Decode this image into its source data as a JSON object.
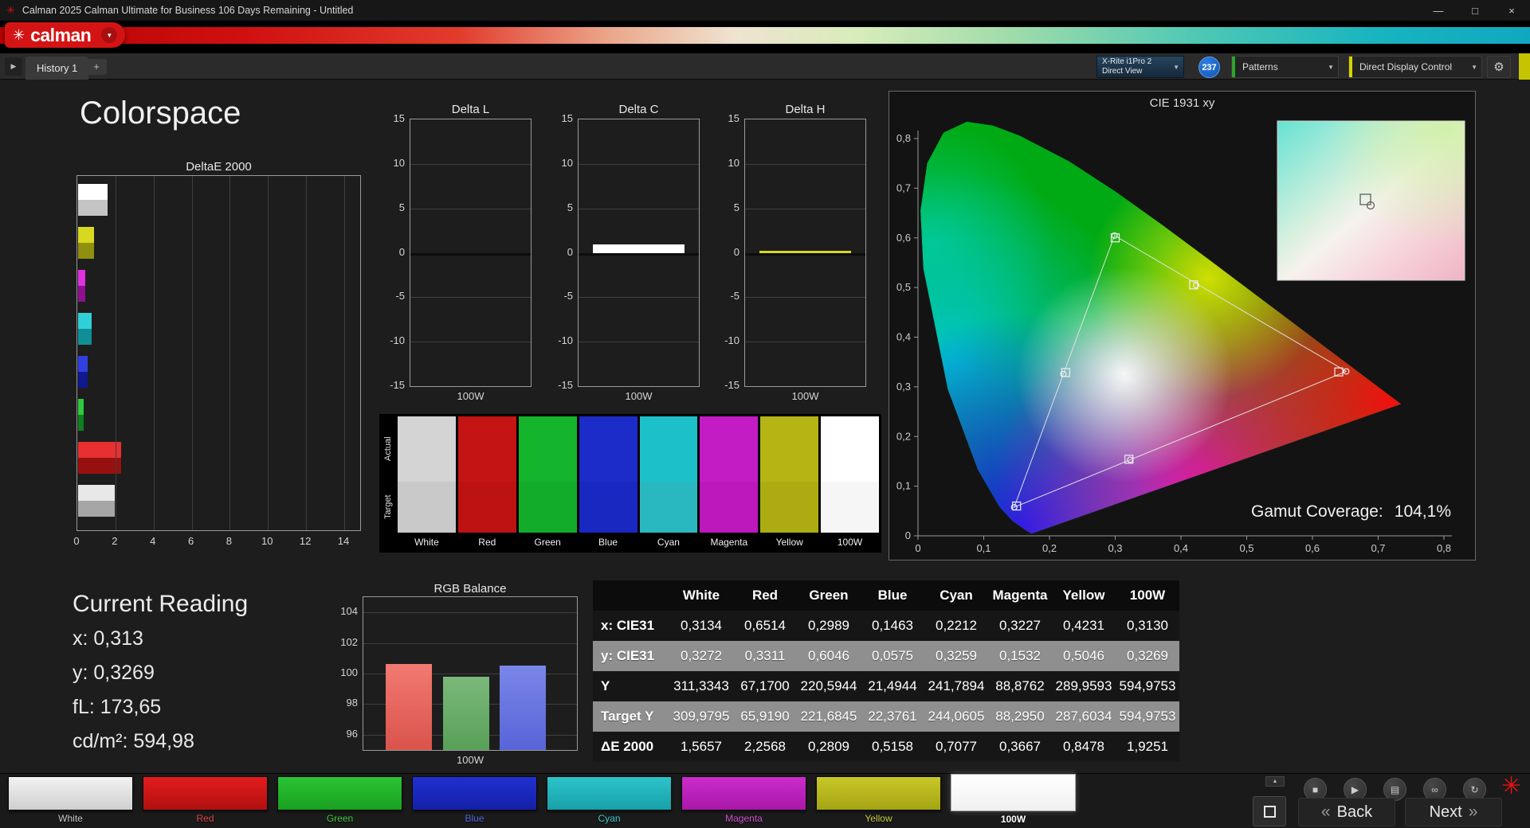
{
  "window": {
    "title": "Calman 2025 Calman Ultimate for Business 106 Days Remaining  - Untitled"
  },
  "brand": {
    "name": "calman"
  },
  "icons": {
    "app": "✳",
    "logo_mark": "✳",
    "dropdown": "▼",
    "minimize": "—",
    "maximize": "□",
    "close": "×",
    "tab_arrow": "▶",
    "gear": "⚙",
    "up": "▲",
    "stop": "■",
    "play": "▶",
    "save": "▤",
    "link": "∞",
    "refresh": "↻",
    "back_chev": "«",
    "next_chev": "»",
    "asterisk": "✳",
    "add": "+"
  },
  "tabbar": {
    "tab": "History 1",
    "meter_line1": "X-Rite i1Pro 2",
    "meter_line2": "Direct View",
    "badge": "237",
    "patterns": "Patterns",
    "display_control": "Direct Display Control"
  },
  "page": {
    "title": "Colorspace"
  },
  "charts": {
    "deltae2000": {
      "type": "bar",
      "title": "DeltaE 2000",
      "x_ticks": [
        "0",
        "2",
        "4",
        "6",
        "8",
        "10",
        "12",
        "14"
      ],
      "x_max": 14,
      "bars": [
        {
          "name": "White",
          "value": 1.5657,
          "c1": "#ffffff",
          "c2": "#c4c4c4"
        },
        {
          "name": "Yellow",
          "value": 0.8478,
          "c1": "#d8d820",
          "c2": "#8f8f10"
        },
        {
          "name": "Magenta",
          "value": 0.3667,
          "c1": "#e030e0",
          "c2": "#8f108f"
        },
        {
          "name": "Cyan",
          "value": 0.7077,
          "c1": "#30d0d8",
          "c2": "#108f97"
        },
        {
          "name": "Blue",
          "value": 0.5158,
          "c1": "#3040e0",
          "c2": "#10188f"
        },
        {
          "name": "Green",
          "value": 0.2809,
          "c1": "#30c840",
          "c2": "#107f20"
        },
        {
          "name": "Red",
          "value": 2.2568,
          "c1": "#e83030",
          "c2": "#971010"
        },
        {
          "name": "100W",
          "value": 1.9251,
          "c1": "#e8e8e8",
          "c2": "#a6a6a6"
        }
      ]
    },
    "delta_l": {
      "type": "bar",
      "title": "Delta L",
      "y_ticks": [
        "15",
        "10",
        "5",
        "0",
        "-5",
        "-10",
        "-15"
      ],
      "x_label": "100W",
      "value": 0.0,
      "color": "#ffffff"
    },
    "delta_c": {
      "type": "bar",
      "title": "Delta C",
      "y_ticks": [
        "15",
        "10",
        "5",
        "0",
        "-5",
        "-10",
        "-15"
      ],
      "x_label": "100W",
      "value": 0.95,
      "color": "#ffffff"
    },
    "delta_h": {
      "type": "bar",
      "title": "Delta H",
      "y_ticks": [
        "15",
        "10",
        "5",
        "0",
        "-5",
        "-10",
        "-15"
      ],
      "x_label": "100W",
      "value": 0.2,
      "color": "#d8d820"
    },
    "rgb_balance": {
      "type": "bar",
      "title": "RGB Balance",
      "y_ticks": [
        "104",
        "102",
        "100",
        "98",
        "96"
      ],
      "y_min": 95,
      "y_max": 105,
      "x_label": "100W",
      "bars": [
        {
          "name": "red",
          "value": 100.6,
          "c1": "#f27a72",
          "c2": "#d9534b"
        },
        {
          "name": "green",
          "value": 99.8,
          "c1": "#7ab87a",
          "c2": "#58a058"
        },
        {
          "name": "blue",
          "value": 100.5,
          "c1": "#7a86e8",
          "c2": "#5864d8"
        }
      ]
    },
    "cie": {
      "type": "scatter",
      "title": "CIE 1931 xy",
      "x_ticks": [
        "0",
        "0,1",
        "0,2",
        "0,3",
        "0,4",
        "0,5",
        "0,6",
        "0,7",
        "0,8"
      ],
      "y_ticks": [
        "0,8",
        "0,7",
        "0,6",
        "0,5",
        "0,4",
        "0,3",
        "0,2",
        "0,1",
        "0"
      ],
      "gamut_label": "Gamut Coverage:",
      "gamut_value": "104,1%",
      "triangle": [
        "red",
        "green",
        "blue"
      ],
      "points": [
        {
          "name": "white",
          "mx": 0.3134,
          "my": 0.3272,
          "tx": 0.3127,
          "ty": 0.329
        },
        {
          "name": "red",
          "mx": 0.6514,
          "my": 0.3311,
          "tx": 0.64,
          "ty": 0.33
        },
        {
          "name": "green",
          "mx": 0.2989,
          "my": 0.6046,
          "tx": 0.3,
          "ty": 0.6
        },
        {
          "name": "blue",
          "mx": 0.1463,
          "my": 0.0575,
          "tx": 0.15,
          "ty": 0.06
        },
        {
          "name": "cyan",
          "mx": 0.2212,
          "my": 0.3259,
          "tx": 0.2246,
          "ty": 0.3287
        },
        {
          "name": "magenta",
          "mx": 0.3227,
          "my": 0.1532,
          "tx": 0.3209,
          "ty": 0.1542
        },
        {
          "name": "yellow",
          "mx": 0.4231,
          "my": 0.5046,
          "tx": 0.4193,
          "ty": 0.5053
        }
      ]
    }
  },
  "swatches": {
    "row_label_actual": "Actual",
    "row_label_target": "Target",
    "columns": [
      {
        "label": "White",
        "actual": "#d4d4d4",
        "target": "#c9c9c9"
      },
      {
        "label": "Red",
        "actual": "#c41414",
        "target": "#bc1212"
      },
      {
        "label": "Green",
        "actual": "#14b42c",
        "target": "#12ac2a"
      },
      {
        "label": "Blue",
        "actual": "#1c2cc8",
        "target": "#1828c0"
      },
      {
        "label": "Cyan",
        "actual": "#1cc0c8",
        "target": "#2ab8c0"
      },
      {
        "label": "Magenta",
        "actual": "#c41cc4",
        "target": "#bc18bc"
      },
      {
        "label": "Yellow",
        "actual": "#b4b414",
        "target": "#acac12"
      },
      {
        "label": "100W",
        "actual": "#ffffff",
        "target": "#f6f6f6"
      }
    ]
  },
  "current_reading": {
    "title": "Current Reading",
    "lines": [
      "x: 0,313",
      "y: 0,3269",
      "fL: 173,65",
      "cd/m²: 594,98"
    ]
  },
  "table": {
    "headers": [
      "",
      "White",
      "Red",
      "Green",
      "Blue",
      "Cyan",
      "Magenta",
      "Yellow",
      "100W"
    ],
    "rows": [
      [
        "x: CIE31",
        "0,3134",
        "0,6514",
        "0,2989",
        "0,1463",
        "0,2212",
        "0,3227",
        "0,4231",
        "0,3130"
      ],
      [
        "y: CIE31",
        "0,3272",
        "0,3311",
        "0,6046",
        "0,0575",
        "0,3259",
        "0,1532",
        "0,5046",
        "0,3269"
      ],
      [
        "Y",
        "311,3343",
        "67,1700",
        "220,5944",
        "21,4944",
        "241,7894",
        "88,8762",
        "289,9593",
        "594,9753"
      ],
      [
        "Target Y",
        "309,9795",
        "65,9190",
        "221,6845",
        "22,3761",
        "244,0605",
        "88,2950",
        "287,6034",
        "594,9753"
      ],
      [
        "ΔE 2000",
        "1,5657",
        "2,2568",
        "0,2809",
        "0,5158",
        "0,7077",
        "0,3667",
        "0,8478",
        "1,9251"
      ]
    ]
  },
  "bottombar": {
    "back": "Back",
    "next": "Next",
    "buttons": [
      {
        "label": "White",
        "c1": "#f2f2f2",
        "c2": "#cfcfcf",
        "label_color": "#cccccc",
        "selected": false
      },
      {
        "label": "Red",
        "c1": "#e41c1c",
        "c2": "#b01010",
        "label_color": "#e04848",
        "selected": false
      },
      {
        "label": "Green",
        "c1": "#2cc434",
        "c2": "#18a020",
        "label_color": "#44cc44",
        "selected": false
      },
      {
        "label": "Blue",
        "c1": "#2030d0",
        "c2": "#1420a8",
        "label_color": "#5868e0",
        "selected": false
      },
      {
        "label": "Cyan",
        "c1": "#2cc4cc",
        "c2": "#18a0a8",
        "label_color": "#44cccc",
        "selected": false
      },
      {
        "label": "Magenta",
        "c1": "#cc2ccc",
        "c2": "#a818a8",
        "label_color": "#d055d0",
        "selected": false
      },
      {
        "label": "Yellow",
        "c1": "#c8c828",
        "c2": "#a4a414",
        "label_color": "#cccc44",
        "selected": false
      },
      {
        "label": "100W",
        "c1": "#ffffff",
        "c2": "#f0f0f0",
        "label_color": "#ffffff",
        "selected": true
      }
    ]
  },
  "colors": {
    "brand_red": "#d41414",
    "badge_blue": "#1356b4",
    "accent_yellow": "#d6d300"
  }
}
